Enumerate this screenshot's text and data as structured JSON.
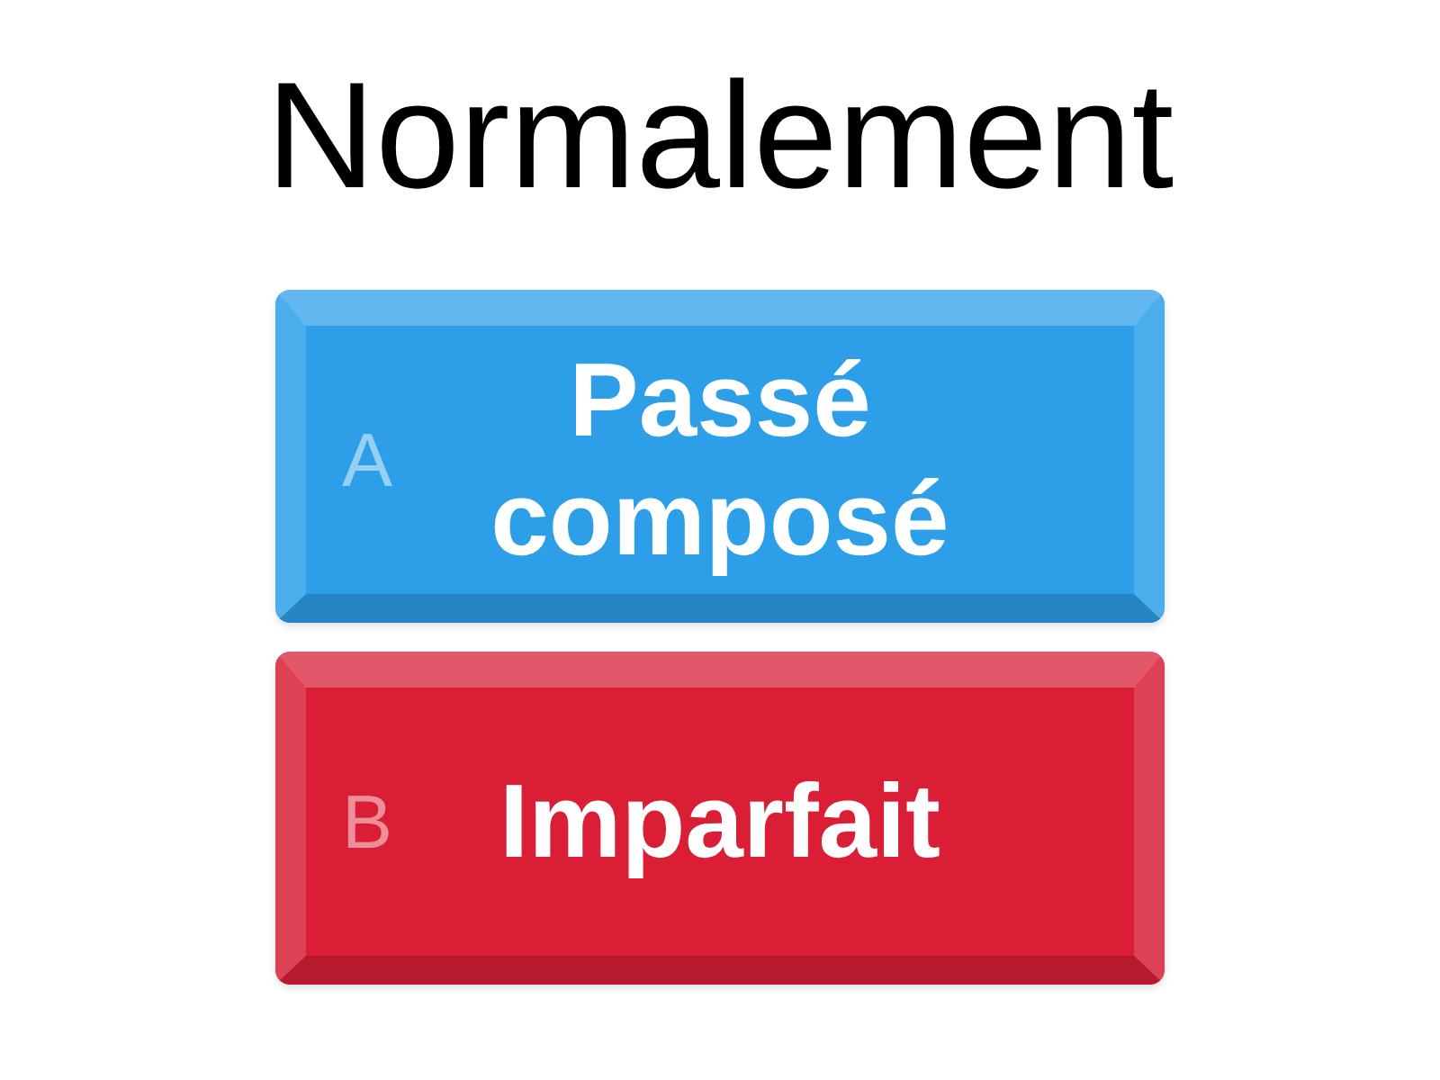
{
  "title": "Normalement",
  "answers": [
    {
      "letter": "A",
      "text": "Passé composé",
      "color": "#2d9fe9"
    },
    {
      "letter": "B",
      "text": "Imparfait",
      "color": "#d91e36"
    }
  ]
}
